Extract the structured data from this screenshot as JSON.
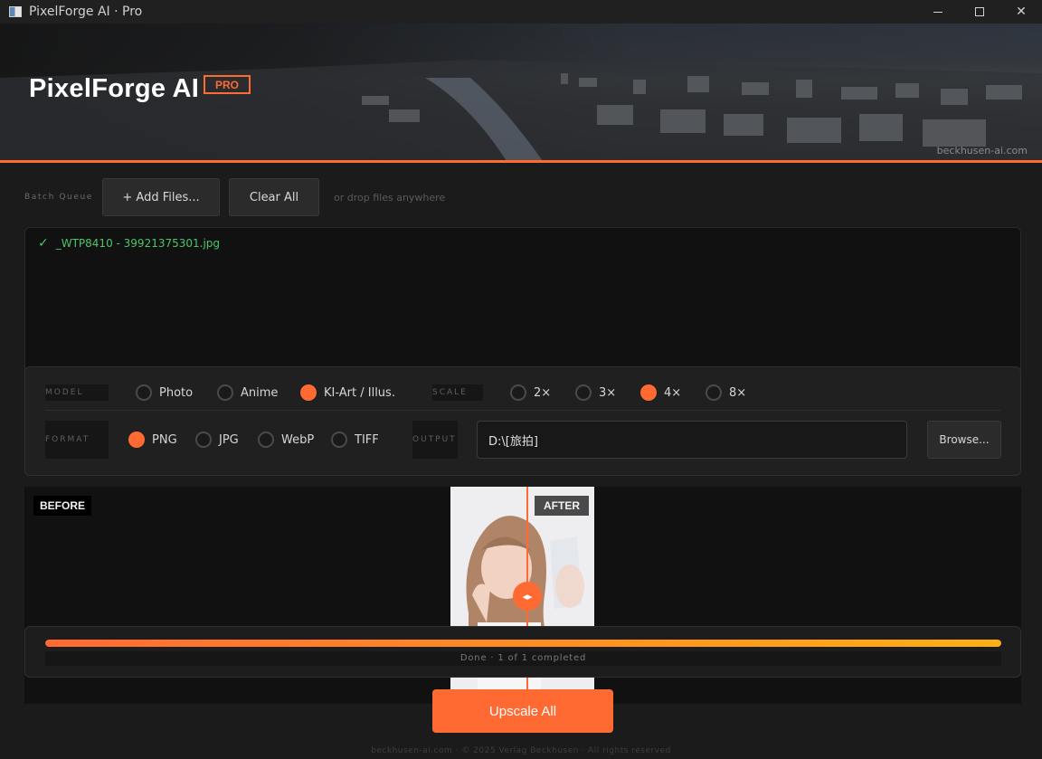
{
  "window": {
    "title": "PixelForge AI · Pro",
    "controls": {
      "minimize": "",
      "maximize": "",
      "close": "✕"
    }
  },
  "banner": {
    "title": "PixelForge AI",
    "badge": "PRO",
    "site": "beckhusen-ai.com"
  },
  "queue": {
    "label": "Batch Queue",
    "add_label": "+ Add Files...",
    "clear_label": "Clear All",
    "drop_hint": "or drop files anywhere",
    "files": [
      {
        "name": "_WTP8410 - 39921375301.jpg",
        "status": "done"
      }
    ]
  },
  "options": {
    "model_label": "MODEL",
    "models": [
      "Photo",
      "Anime",
      "KI-Art / Illus."
    ],
    "model_selected": "KI-Art / Illus.",
    "scale_label": "SCALE",
    "scales": [
      "2×",
      "3×",
      "4×",
      "8×"
    ],
    "scale_selected": "4×",
    "format_label": "FORMAT",
    "formats": [
      "PNG",
      "JPG",
      "WebP",
      "TIFF"
    ],
    "format_selected": "PNG",
    "output_label": "OUTPUT",
    "output_path": "D:\\[旅拍]",
    "browse_label": "Browse..."
  },
  "preview": {
    "before_label": "BEFORE",
    "after_label": "AFTER"
  },
  "progress": {
    "fraction": 1.0,
    "text": "Done  ·  1 of 1 completed"
  },
  "actions": {
    "upscale_label": "Upscale All"
  },
  "footer": {
    "text": "beckhusen-ai.com  ·  © 2025 Verlag Beckhusen  ·  All rights reserved"
  },
  "colors": {
    "accent": "#ff6a33",
    "success": "#4cc46a",
    "background": "#1b1b1b"
  }
}
